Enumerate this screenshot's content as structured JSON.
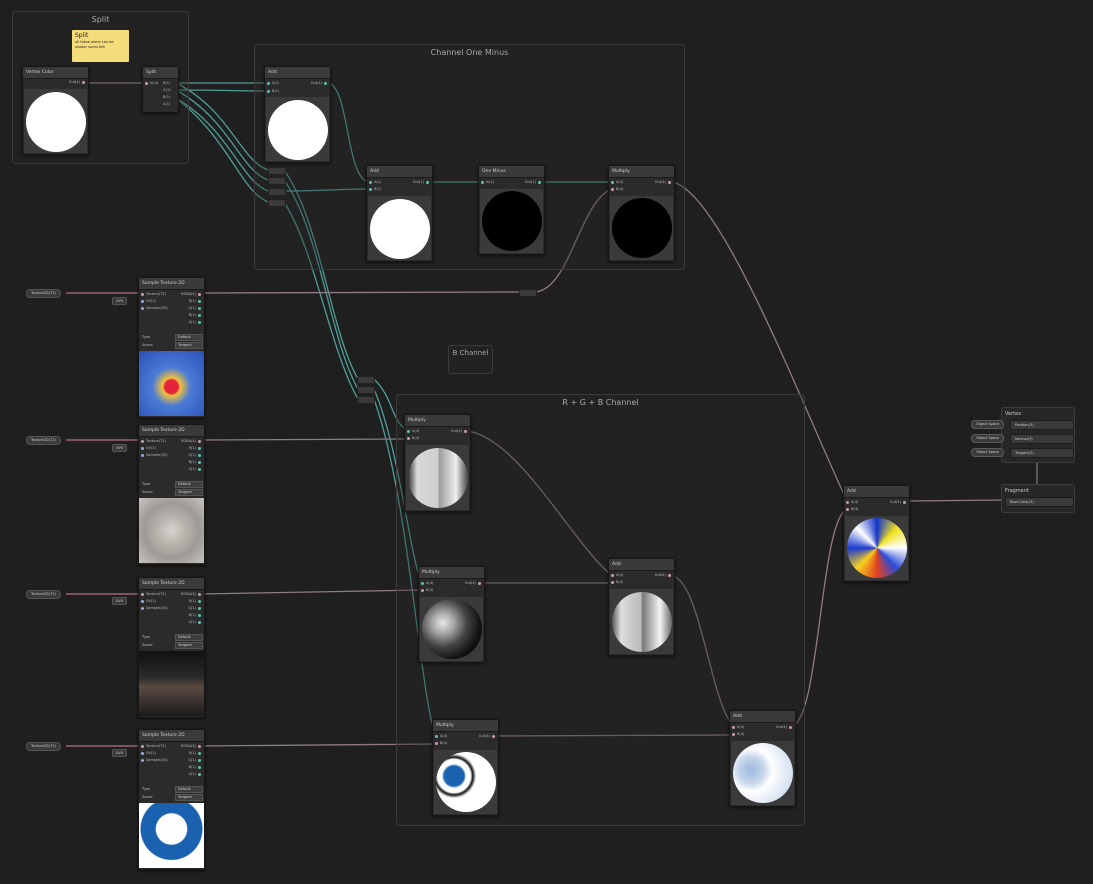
{
  "groups": {
    "split": "Split",
    "channel_one_minus": "Channel One Minus",
    "b_channel": "B Channel",
    "rgb": "R + G + B Channel"
  },
  "sticky": {
    "title": "Split",
    "body": "all these alone can be shader sucks tbh"
  },
  "vertex_color": {
    "title": "Vertex Color",
    "out": "Out(4)"
  },
  "split_node": {
    "title": "Split",
    "in": "In(4)",
    "outs": [
      "R(1)",
      "G(1)",
      "B(1)",
      "A(1)"
    ]
  },
  "add_top": {
    "title": "Add",
    "in_a": "A(1)",
    "in_b": "B(1)",
    "out": "Out(1)"
  },
  "add_mid": {
    "title": "Add",
    "in_a": "A(1)",
    "in_b": "B(1)",
    "out": "Out(1)"
  },
  "one_minus": {
    "title": "One Minus",
    "in": "In(1)",
    "out": "Out(1)"
  },
  "multiply_top": {
    "title": "Multiply",
    "in_a": "A(4)",
    "in_b": "B(4)",
    "out": "Out(4)"
  },
  "samplers": [
    {
      "title": "Sample Texture 2D",
      "tex_prop": "Texture2D(T2)",
      "ports": [
        "Texture(T2)",
        "UV(2)",
        "Sampler(SS)"
      ],
      "outs": [
        "RGBA(4)",
        "R(1)",
        "G(1)",
        "B(1)",
        "A(1)"
      ],
      "uv": "UV0",
      "type_label": "Type",
      "type_value": "Default",
      "space_label": "Space",
      "space_value": "Tangent"
    },
    {
      "title": "Sample Texture 2D",
      "tex_prop": "Texture2D(T2)",
      "ports": [
        "Texture(T2)",
        "UV(2)",
        "Sampler(SS)"
      ],
      "outs": [
        "RGBA(4)",
        "R(1)",
        "G(1)",
        "B(1)",
        "A(1)"
      ],
      "uv": "UV0",
      "type_label": "Type",
      "type_value": "Default",
      "space_label": "Space",
      "space_value": "Tangent"
    },
    {
      "title": "Sample Texture 2D",
      "tex_prop": "Texture2D(T2)",
      "ports": [
        "Texture(T2)",
        "UV(2)",
        "Sampler(SS)"
      ],
      "outs": [
        "RGBA(4)",
        "R(1)",
        "G(1)",
        "B(1)",
        "A(1)"
      ],
      "uv": "UV0",
      "type_label": "Type",
      "type_value": "Default",
      "space_label": "Space",
      "space_value": "Tangent"
    },
    {
      "title": "Sample Texture 2D",
      "tex_prop": "Texture2D(T2)",
      "ports": [
        "Texture(T2)",
        "UV(2)",
        "Sampler(SS)"
      ],
      "outs": [
        "RGBA(4)",
        "R(1)",
        "G(1)",
        "B(1)",
        "A(1)"
      ],
      "uv": "UV0",
      "type_label": "Type",
      "type_value": "Default",
      "space_label": "Space",
      "space_value": "Tangent"
    }
  ],
  "multiply_1": {
    "title": "Multiply",
    "in_a": "A(4)",
    "in_b": "B(4)",
    "out": "Out(4)"
  },
  "multiply_2": {
    "title": "Multiply",
    "in_a": "A(4)",
    "in_b": "B(4)",
    "out": "Out(4)"
  },
  "multiply_3": {
    "title": "Multiply",
    "in_a": "A(4)",
    "in_b": "B(4)",
    "out": "Out(4)"
  },
  "add_rg": {
    "title": "Add",
    "in_a": "A(4)",
    "in_b": "B(4)",
    "out": "Out(4)"
  },
  "add_rgb": {
    "title": "Add",
    "in_a": "A(4)",
    "in_b": "B(4)",
    "out": "Out(4)"
  },
  "add_final": {
    "title": "Add",
    "in_a": "A(4)",
    "in_b": "B(4)",
    "out": "Out(4)"
  },
  "vertex_ctx": {
    "title": "Vertex",
    "rows": [
      {
        "tag": "Object Space",
        "label": "Position(3)"
      },
      {
        "tag": "Object Space",
        "label": "Normal(3)"
      },
      {
        "tag": "Object Space",
        "label": "Tangent(3)"
      }
    ]
  },
  "fragment_ctx": {
    "title": "Fragment",
    "rows": [
      {
        "label": "Base Color(3)"
      }
    ]
  },
  "colors": {
    "wire_float": "#4f9e97",
    "wire_vector": "#8f7a86",
    "wire_texture": "#b4717f",
    "sticky": "#f5dc7a"
  }
}
